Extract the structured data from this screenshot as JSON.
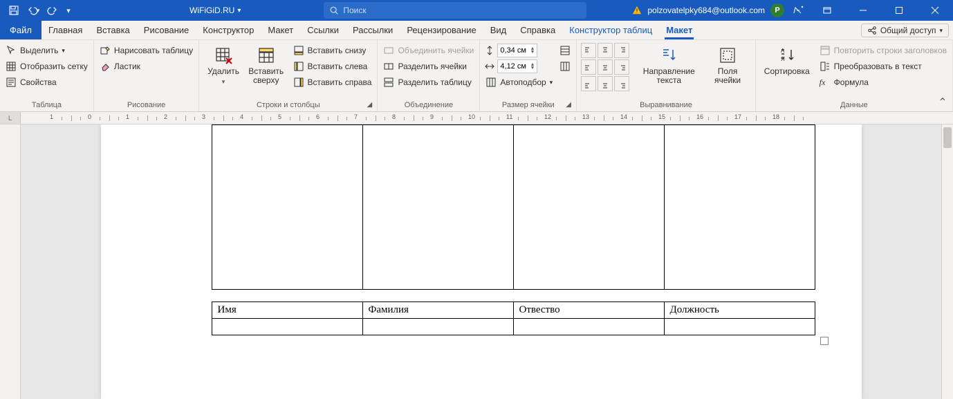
{
  "title": {
    "document": "WiFiGiD.RU",
    "search_placeholder": "Поиск",
    "user_email": "polzovatelpky684@outlook.com",
    "avatar_initial": "P"
  },
  "tabs": {
    "file": "Файл",
    "items": [
      "Главная",
      "Вставка",
      "Рисование",
      "Конструктор",
      "Макет",
      "Ссылки",
      "Рассылки",
      "Рецензирование",
      "Вид",
      "Справка"
    ],
    "context": [
      "Конструктор таблиц",
      "Макет"
    ],
    "active": "Макет",
    "share": "Общий доступ"
  },
  "ribbon": {
    "table": {
      "label": "Таблица",
      "select": "Выделить",
      "gridlines": "Отобразить сетку",
      "props": "Свойства"
    },
    "draw": {
      "label": "Рисование",
      "draw": "Нарисовать таблицу",
      "eraser": "Ластик"
    },
    "rowscols": {
      "label": "Строки и столбцы",
      "delete": "Удалить",
      "insert_above": "Вставить сверху",
      "insert_below": "Вставить снизу",
      "insert_left": "Вставить слева",
      "insert_right": "Вставить справа"
    },
    "merge": {
      "label": "Объединение",
      "merge": "Объединить ячейки",
      "split": "Разделить ячейки",
      "split_table": "Разделить таблицу"
    },
    "size": {
      "label": "Размер ячейки",
      "height": "0,34 см",
      "width": "4,12 см",
      "autofit": "Автоподбор"
    },
    "align": {
      "label": "Выравнивание",
      "textdir": "Направление текста",
      "margins": "Поля ячейки"
    },
    "data": {
      "label": "Данные",
      "sort": "Сортировка",
      "repeat": "Повторить строки заголовков",
      "convert": "Преобразовать в текст",
      "formula": "Формула"
    }
  },
  "doc": {
    "headers": [
      "Имя",
      "Фамилия",
      "Отвество",
      "Должность"
    ]
  }
}
